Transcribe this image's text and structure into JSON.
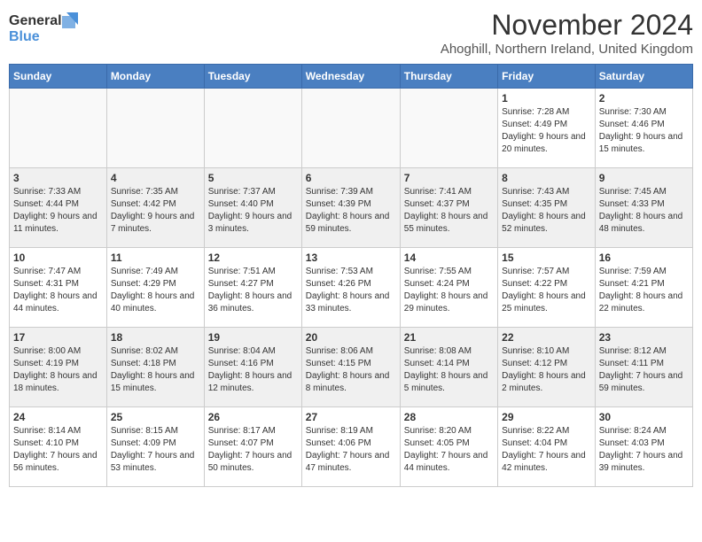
{
  "logo": {
    "line1": "General",
    "line2": "Blue"
  },
  "title": "November 2024",
  "location": "Ahoghill, Northern Ireland, United Kingdom",
  "weekdays": [
    "Sunday",
    "Monday",
    "Tuesday",
    "Wednesday",
    "Thursday",
    "Friday",
    "Saturday"
  ],
  "weeks": [
    [
      {
        "day": "",
        "info": ""
      },
      {
        "day": "",
        "info": ""
      },
      {
        "day": "",
        "info": ""
      },
      {
        "day": "",
        "info": ""
      },
      {
        "day": "",
        "info": ""
      },
      {
        "day": "1",
        "info": "Sunrise: 7:28 AM\nSunset: 4:49 PM\nDaylight: 9 hours and 20 minutes."
      },
      {
        "day": "2",
        "info": "Sunrise: 7:30 AM\nSunset: 4:46 PM\nDaylight: 9 hours and 15 minutes."
      }
    ],
    [
      {
        "day": "3",
        "info": "Sunrise: 7:33 AM\nSunset: 4:44 PM\nDaylight: 9 hours and 11 minutes."
      },
      {
        "day": "4",
        "info": "Sunrise: 7:35 AM\nSunset: 4:42 PM\nDaylight: 9 hours and 7 minutes."
      },
      {
        "day": "5",
        "info": "Sunrise: 7:37 AM\nSunset: 4:40 PM\nDaylight: 9 hours and 3 minutes."
      },
      {
        "day": "6",
        "info": "Sunrise: 7:39 AM\nSunset: 4:39 PM\nDaylight: 8 hours and 59 minutes."
      },
      {
        "day": "7",
        "info": "Sunrise: 7:41 AM\nSunset: 4:37 PM\nDaylight: 8 hours and 55 minutes."
      },
      {
        "day": "8",
        "info": "Sunrise: 7:43 AM\nSunset: 4:35 PM\nDaylight: 8 hours and 52 minutes."
      },
      {
        "day": "9",
        "info": "Sunrise: 7:45 AM\nSunset: 4:33 PM\nDaylight: 8 hours and 48 minutes."
      }
    ],
    [
      {
        "day": "10",
        "info": "Sunrise: 7:47 AM\nSunset: 4:31 PM\nDaylight: 8 hours and 44 minutes."
      },
      {
        "day": "11",
        "info": "Sunrise: 7:49 AM\nSunset: 4:29 PM\nDaylight: 8 hours and 40 minutes."
      },
      {
        "day": "12",
        "info": "Sunrise: 7:51 AM\nSunset: 4:27 PM\nDaylight: 8 hours and 36 minutes."
      },
      {
        "day": "13",
        "info": "Sunrise: 7:53 AM\nSunset: 4:26 PM\nDaylight: 8 hours and 33 minutes."
      },
      {
        "day": "14",
        "info": "Sunrise: 7:55 AM\nSunset: 4:24 PM\nDaylight: 8 hours and 29 minutes."
      },
      {
        "day": "15",
        "info": "Sunrise: 7:57 AM\nSunset: 4:22 PM\nDaylight: 8 hours and 25 minutes."
      },
      {
        "day": "16",
        "info": "Sunrise: 7:59 AM\nSunset: 4:21 PM\nDaylight: 8 hours and 22 minutes."
      }
    ],
    [
      {
        "day": "17",
        "info": "Sunrise: 8:00 AM\nSunset: 4:19 PM\nDaylight: 8 hours and 18 minutes."
      },
      {
        "day": "18",
        "info": "Sunrise: 8:02 AM\nSunset: 4:18 PM\nDaylight: 8 hours and 15 minutes."
      },
      {
        "day": "19",
        "info": "Sunrise: 8:04 AM\nSunset: 4:16 PM\nDaylight: 8 hours and 12 minutes."
      },
      {
        "day": "20",
        "info": "Sunrise: 8:06 AM\nSunset: 4:15 PM\nDaylight: 8 hours and 8 minutes."
      },
      {
        "day": "21",
        "info": "Sunrise: 8:08 AM\nSunset: 4:14 PM\nDaylight: 8 hours and 5 minutes."
      },
      {
        "day": "22",
        "info": "Sunrise: 8:10 AM\nSunset: 4:12 PM\nDaylight: 8 hours and 2 minutes."
      },
      {
        "day": "23",
        "info": "Sunrise: 8:12 AM\nSunset: 4:11 PM\nDaylight: 7 hours and 59 minutes."
      }
    ],
    [
      {
        "day": "24",
        "info": "Sunrise: 8:14 AM\nSunset: 4:10 PM\nDaylight: 7 hours and 56 minutes."
      },
      {
        "day": "25",
        "info": "Sunrise: 8:15 AM\nSunset: 4:09 PM\nDaylight: 7 hours and 53 minutes."
      },
      {
        "day": "26",
        "info": "Sunrise: 8:17 AM\nSunset: 4:07 PM\nDaylight: 7 hours and 50 minutes."
      },
      {
        "day": "27",
        "info": "Sunrise: 8:19 AM\nSunset: 4:06 PM\nDaylight: 7 hours and 47 minutes."
      },
      {
        "day": "28",
        "info": "Sunrise: 8:20 AM\nSunset: 4:05 PM\nDaylight: 7 hours and 44 minutes."
      },
      {
        "day": "29",
        "info": "Sunrise: 8:22 AM\nSunset: 4:04 PM\nDaylight: 7 hours and 42 minutes."
      },
      {
        "day": "30",
        "info": "Sunrise: 8:24 AM\nSunset: 4:03 PM\nDaylight: 7 hours and 39 minutes."
      }
    ]
  ]
}
